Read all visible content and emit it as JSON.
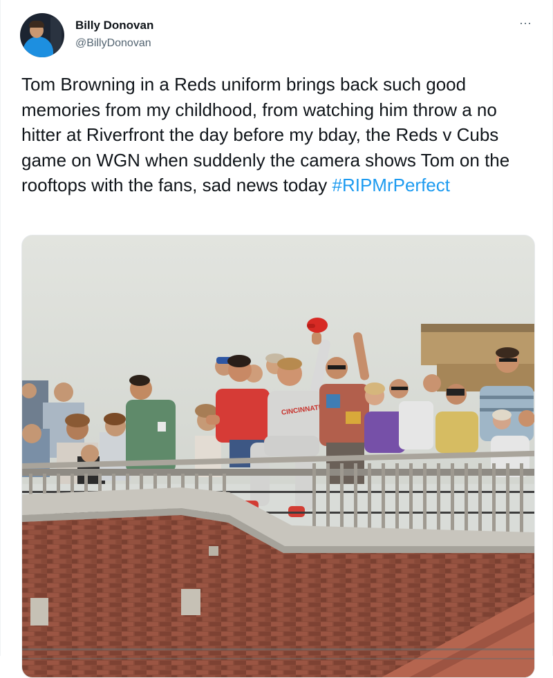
{
  "author": {
    "display_name": "Billy Donovan",
    "handle": "@BillyDonovan",
    "avatar_icon": "user-avatar",
    "more_icon": "more-options-icon",
    "more_glyph": "···"
  },
  "tweet": {
    "text": "Tom Browning in a Reds uniform brings back such good memories from my childhood, from watching him throw a no hitter at Riverfront the day before my bday, the Reds v Cubs game on WGN when suddenly the camera shows Tom on the rooftops with the fans, sad news today ",
    "hashtag": "#RIPMrPerfect",
    "photo_jersey_text": "CINCINNATI"
  },
  "colors": {
    "accent": "#1d9bf0",
    "secondary_text": "#536471",
    "text": "#0f1419"
  }
}
